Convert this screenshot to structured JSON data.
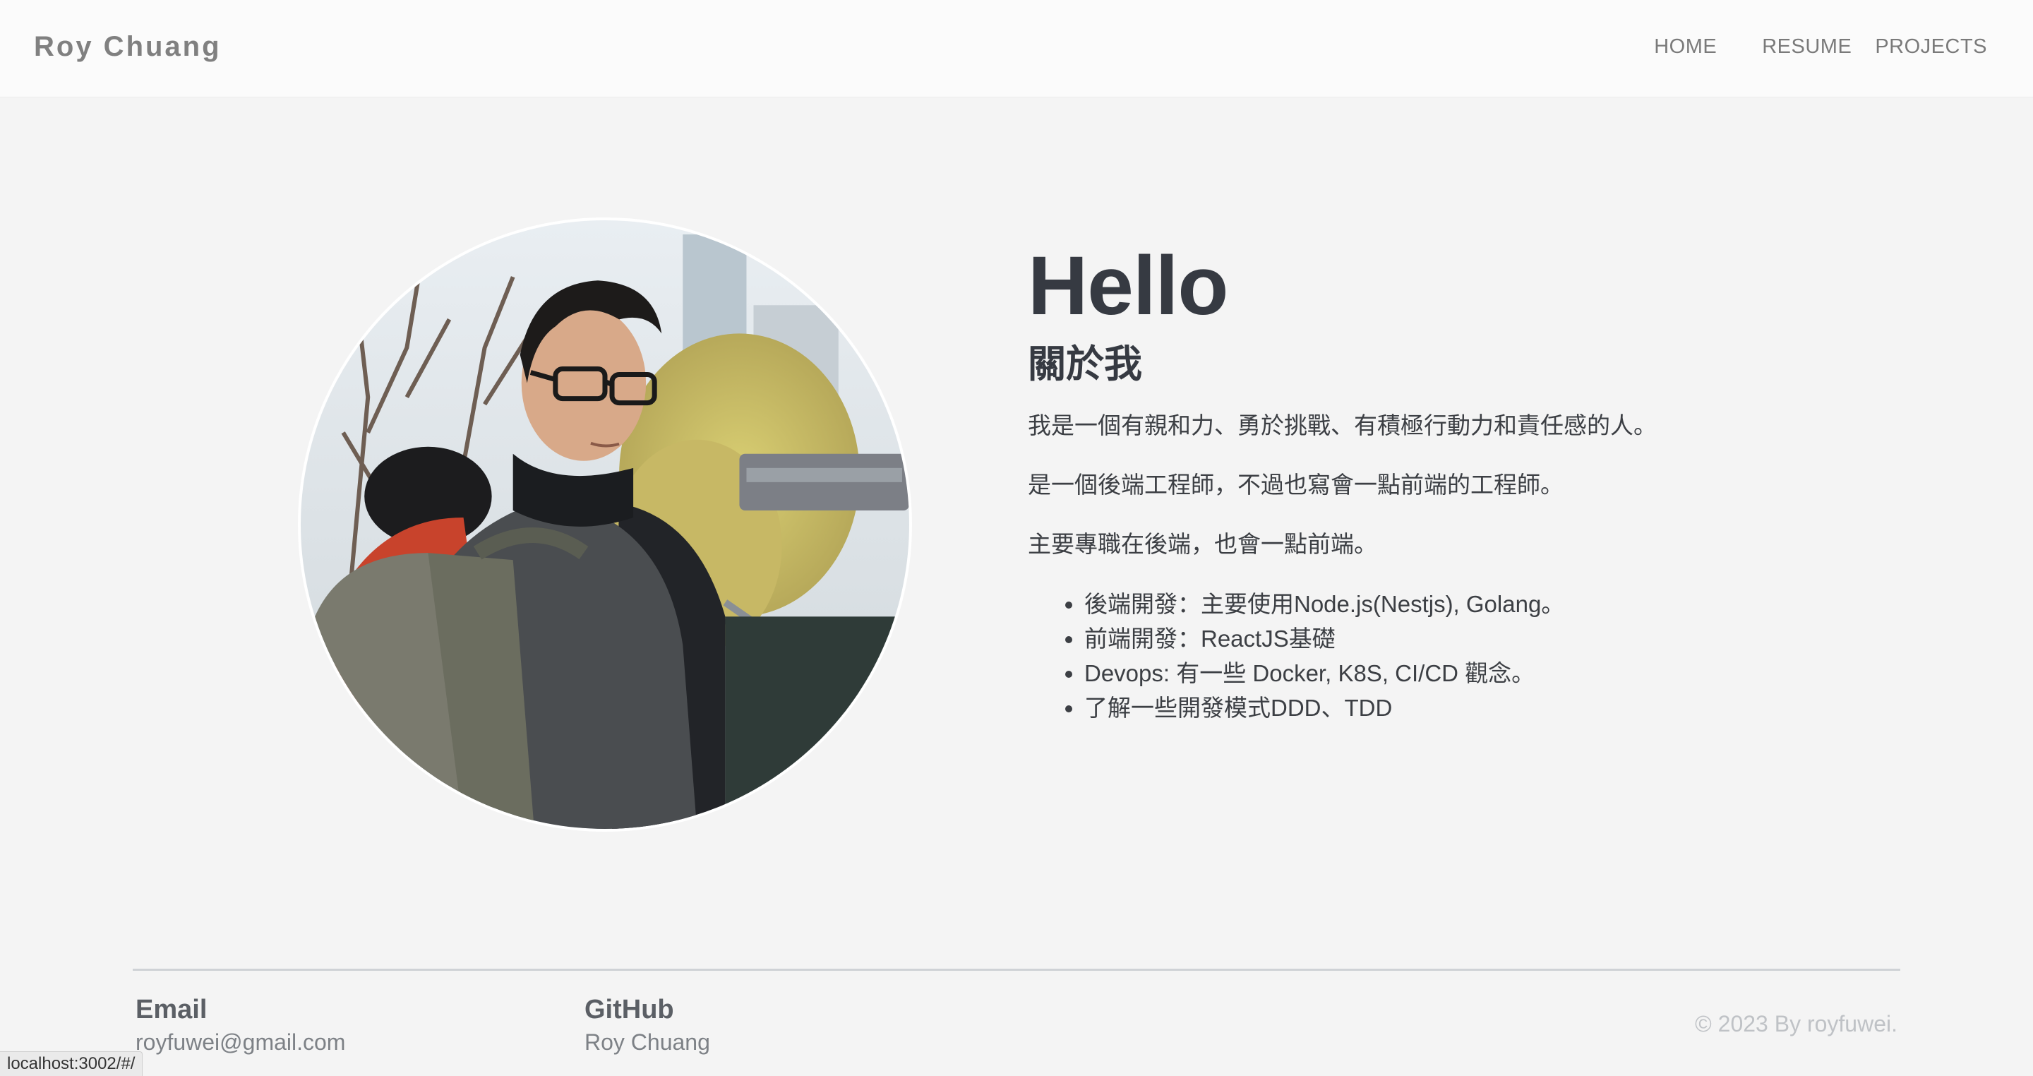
{
  "navbar": {
    "brand": "Roy Chuang",
    "links": [
      "HOME",
      "RESUME",
      "PROJECTS"
    ]
  },
  "hero": {
    "avatar_alt": "profile photo",
    "greeting": "Hello",
    "about_heading": "關於我",
    "paragraphs": [
      "我是一個有親和力、勇於挑戰、有積極行動力和責任感的人。",
      "是一個後端工程師，不過也寫會一點前端的工程師。",
      "主要專職在後端，也會一點前端。"
    ],
    "skills": [
      "後端開發：主要使用Node.js(Nestjs), Golang。",
      "前端開發：ReactJS基礎",
      "Devops: 有一些 Docker, K8S, CI/CD 觀念。",
      "了解一些開發模式DDD、TDD"
    ]
  },
  "footer": {
    "email_title": "Email",
    "email_value": "royfuwei@gmail.com",
    "github_title": "GitHub",
    "github_value": "Roy Chuang",
    "copyright": "© 2023 By royfuwei."
  },
  "status_bar": {
    "url": "localhost:3002/#/"
  }
}
